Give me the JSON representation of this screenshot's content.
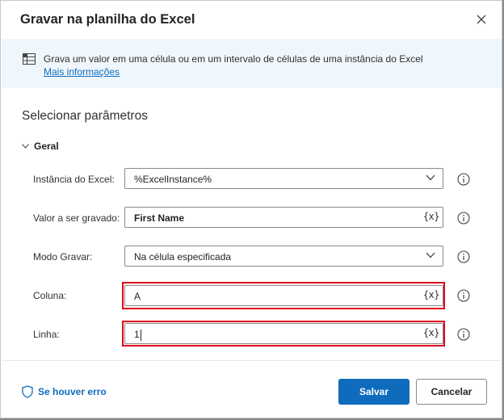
{
  "dialog": {
    "title": "Gravar na planilha do Excel"
  },
  "info": {
    "text": "Grava um valor em uma célula ou em um intervalo de células de uma instância do Excel",
    "link": "Mais informações"
  },
  "section": {
    "title": "Selecionar parâmetros",
    "group": "Geral"
  },
  "fields": {
    "instance": {
      "label": "Instância do Excel:",
      "value": "%ExcelInstance%"
    },
    "value": {
      "label": "Valor a ser gravado:",
      "value": "First Name",
      "var": "{x}"
    },
    "mode": {
      "label": "Modo Gravar:",
      "value": "Na célula especificada"
    },
    "column": {
      "label": "Coluna:",
      "value": "A",
      "var": "{x}"
    },
    "row": {
      "label": "Linha:",
      "value": "1",
      "var": "{x}"
    }
  },
  "footer": {
    "error_link": "Se houver erro",
    "save": "Salvar",
    "cancel": "Cancelar"
  },
  "colors": {
    "primary": "#0f6cbd",
    "highlight": "#e0001b",
    "banner": "#eff6fc"
  },
  "icons": [
    "close-icon",
    "excel-table-icon",
    "chevron-down-icon",
    "info-circle-icon",
    "shield-icon"
  ]
}
